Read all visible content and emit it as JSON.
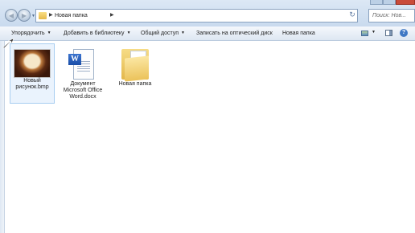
{
  "address": {
    "path_label": "Новая папка",
    "search_placeholder": "Поиск: Нов..."
  },
  "toolbar": {
    "organize_label": "Упорядочить",
    "library_label": "Добавить в библиотеку",
    "share_label": "Общий доступ",
    "burn_label": "Записать на оптический диск",
    "new_folder_label": "Новая папка",
    "caret": "▼"
  },
  "files": [
    {
      "label": "Новый рисунок.bmp",
      "icon": "bmp-thumbnail-icon",
      "selected": true
    },
    {
      "label": "Документ Microsoft Office Word.docx",
      "icon": "word-document-icon",
      "selected": false
    },
    {
      "label": "Новая папка",
      "icon": "folder-icon",
      "selected": false
    }
  ],
  "colors": {
    "accent": "#3f78c4",
    "selection": "#eaf3fd",
    "folder": "#e6b94a"
  }
}
